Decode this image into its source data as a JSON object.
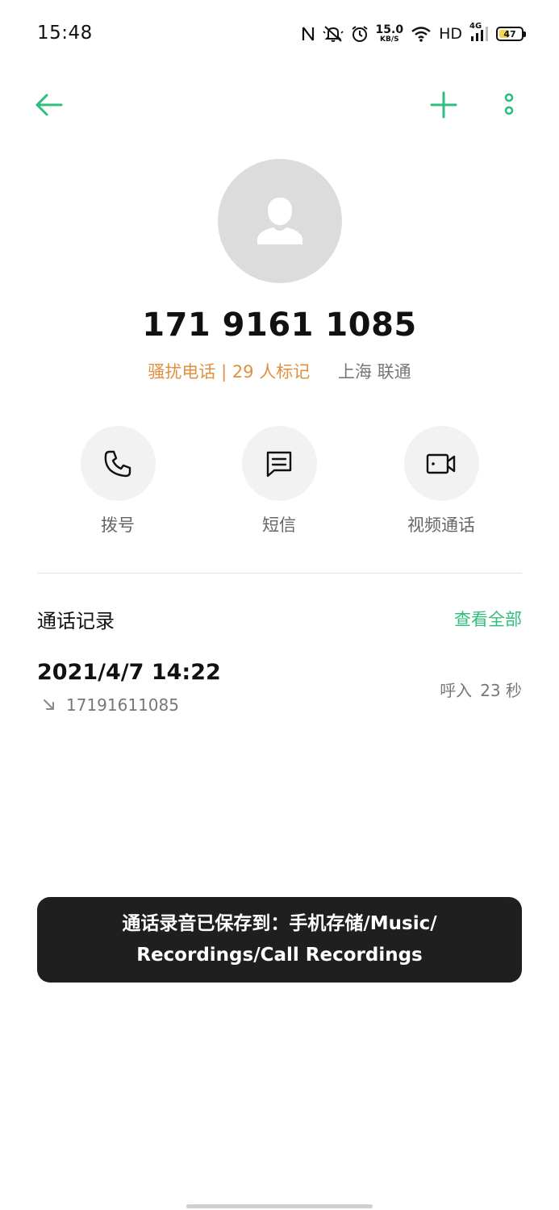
{
  "status_bar": {
    "time": "15:48",
    "net_speed_value": "15.0",
    "net_speed_unit": "KB/S",
    "hd": "HD",
    "signal_type": "4G",
    "battery": "47",
    "battery_level_percent": 47,
    "icons": [
      "nfc-icon",
      "mute-icon",
      "alarm-icon",
      "wifi-icon",
      "signal-icon",
      "battery-icon"
    ]
  },
  "toolbar": {
    "back_icon": "arrow-left-icon",
    "add_icon": "plus-icon",
    "more_icon": "more-vertical-icon"
  },
  "contact": {
    "avatar_icon": "person-icon",
    "phone_number": "171 9161 1085",
    "spam_label": "骚扰电话 | 29 人标记",
    "location": "上海 联通"
  },
  "actions": [
    {
      "label": "拨号",
      "icon": "phone-icon"
    },
    {
      "label": "短信",
      "icon": "message-icon"
    },
    {
      "label": "视频通话",
      "icon": "video-icon"
    }
  ],
  "call_log": {
    "title": "通话记录",
    "view_all": "查看全部",
    "entries": [
      {
        "datetime": "2021/4/7 14:22",
        "number": "17191611085",
        "direction": "呼入",
        "duration": "23 秒",
        "icon": "incoming-call-icon"
      }
    ]
  },
  "toast": {
    "line1": "通话录音已保存到：手机存储/Music/",
    "line2": "Recordings/Call Recordings"
  },
  "colors": {
    "accent": "#2fbe7e",
    "spam": "#e0913f",
    "toast_bg": "#1f1f1f"
  }
}
